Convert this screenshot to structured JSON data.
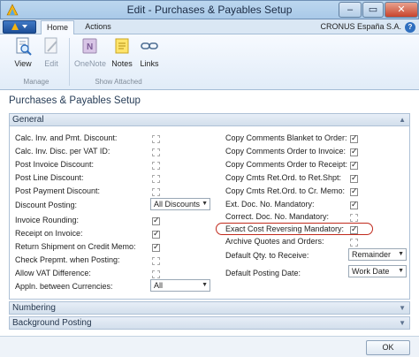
{
  "window": {
    "title": "Edit - Purchases & Payables Setup",
    "min_glyph": "–",
    "max_glyph": "▭",
    "close_glyph": "✕"
  },
  "tabs": {
    "home": "Home",
    "actions": "Actions"
  },
  "company": "CRONUS España S.A.",
  "ribbon": {
    "manage": {
      "label": "Manage",
      "view": "View",
      "edit": "Edit"
    },
    "show_attached": {
      "label": "Show Attached",
      "onenote": "OneNote",
      "notes": "Notes",
      "links": "Links"
    }
  },
  "page_caption": "Purchases & Payables Setup",
  "general": {
    "header": "General",
    "left": [
      {
        "label": "Calc. Inv. and Pmt. Discount:",
        "type": "checkbox",
        "checked": false
      },
      {
        "label": "Calc. Inv. Disc. per VAT ID:",
        "type": "checkbox",
        "checked": false
      },
      {
        "label": "Post Invoice Discount:",
        "type": "checkbox",
        "checked": false
      },
      {
        "label": "Post Line Discount:",
        "type": "checkbox",
        "checked": false
      },
      {
        "label": "Post Payment Discount:",
        "type": "checkbox",
        "checked": false
      },
      {
        "label": "Discount Posting:",
        "type": "select",
        "value": "All Discounts"
      },
      {
        "label": "Invoice Rounding:",
        "type": "checkbox",
        "checked": true
      },
      {
        "label": "Receipt on Invoice:",
        "type": "checkbox",
        "checked": true
      },
      {
        "label": "Return Shipment on Credit Memo:",
        "type": "checkbox",
        "checked": true
      },
      {
        "label": "Check Prepmt. when Posting:",
        "type": "checkbox",
        "checked": false
      },
      {
        "label": "Allow VAT Difference:",
        "type": "checkbox",
        "checked": false
      },
      {
        "label": "Appln. between Currencies:",
        "type": "select",
        "value": "All"
      }
    ],
    "right": [
      {
        "label": "Copy Comments Blanket to Order:",
        "type": "checkbox",
        "checked": true
      },
      {
        "label": "Copy Comments Order to Invoice:",
        "type": "checkbox",
        "checked": true
      },
      {
        "label": "Copy Comments Order to Receipt:",
        "type": "checkbox",
        "checked": true
      },
      {
        "label": "Copy Cmts Ret.Ord. to Ret.Shpt:",
        "type": "checkbox",
        "checked": true
      },
      {
        "label": "Copy Cmts Ret.Ord. to Cr. Memo:",
        "type": "checkbox",
        "checked": true
      },
      {
        "label": "Ext. Doc. No. Mandatory:",
        "type": "checkbox",
        "checked": true
      },
      {
        "label": "Correct. Doc. No. Mandatory:",
        "type": "checkbox",
        "checked": false
      },
      {
        "label": "Exact Cost Reversing Mandatory:",
        "type": "checkbox",
        "checked": true,
        "highlighted": true
      },
      {
        "label": "Archive Quotes and Orders:",
        "type": "checkbox",
        "checked": false
      },
      {
        "label": "Default Qty. to Receive:",
        "type": "select",
        "value": "Remainder"
      },
      {
        "label": "Default Posting Date:",
        "type": "select",
        "value": "Work Date"
      }
    ]
  },
  "sections": {
    "numbering": "Numbering",
    "background_posting": "Background Posting"
  },
  "ok_button": "OK",
  "colors": {
    "highlight_ring": "#c0291c",
    "accent": "#2f6fbf"
  }
}
